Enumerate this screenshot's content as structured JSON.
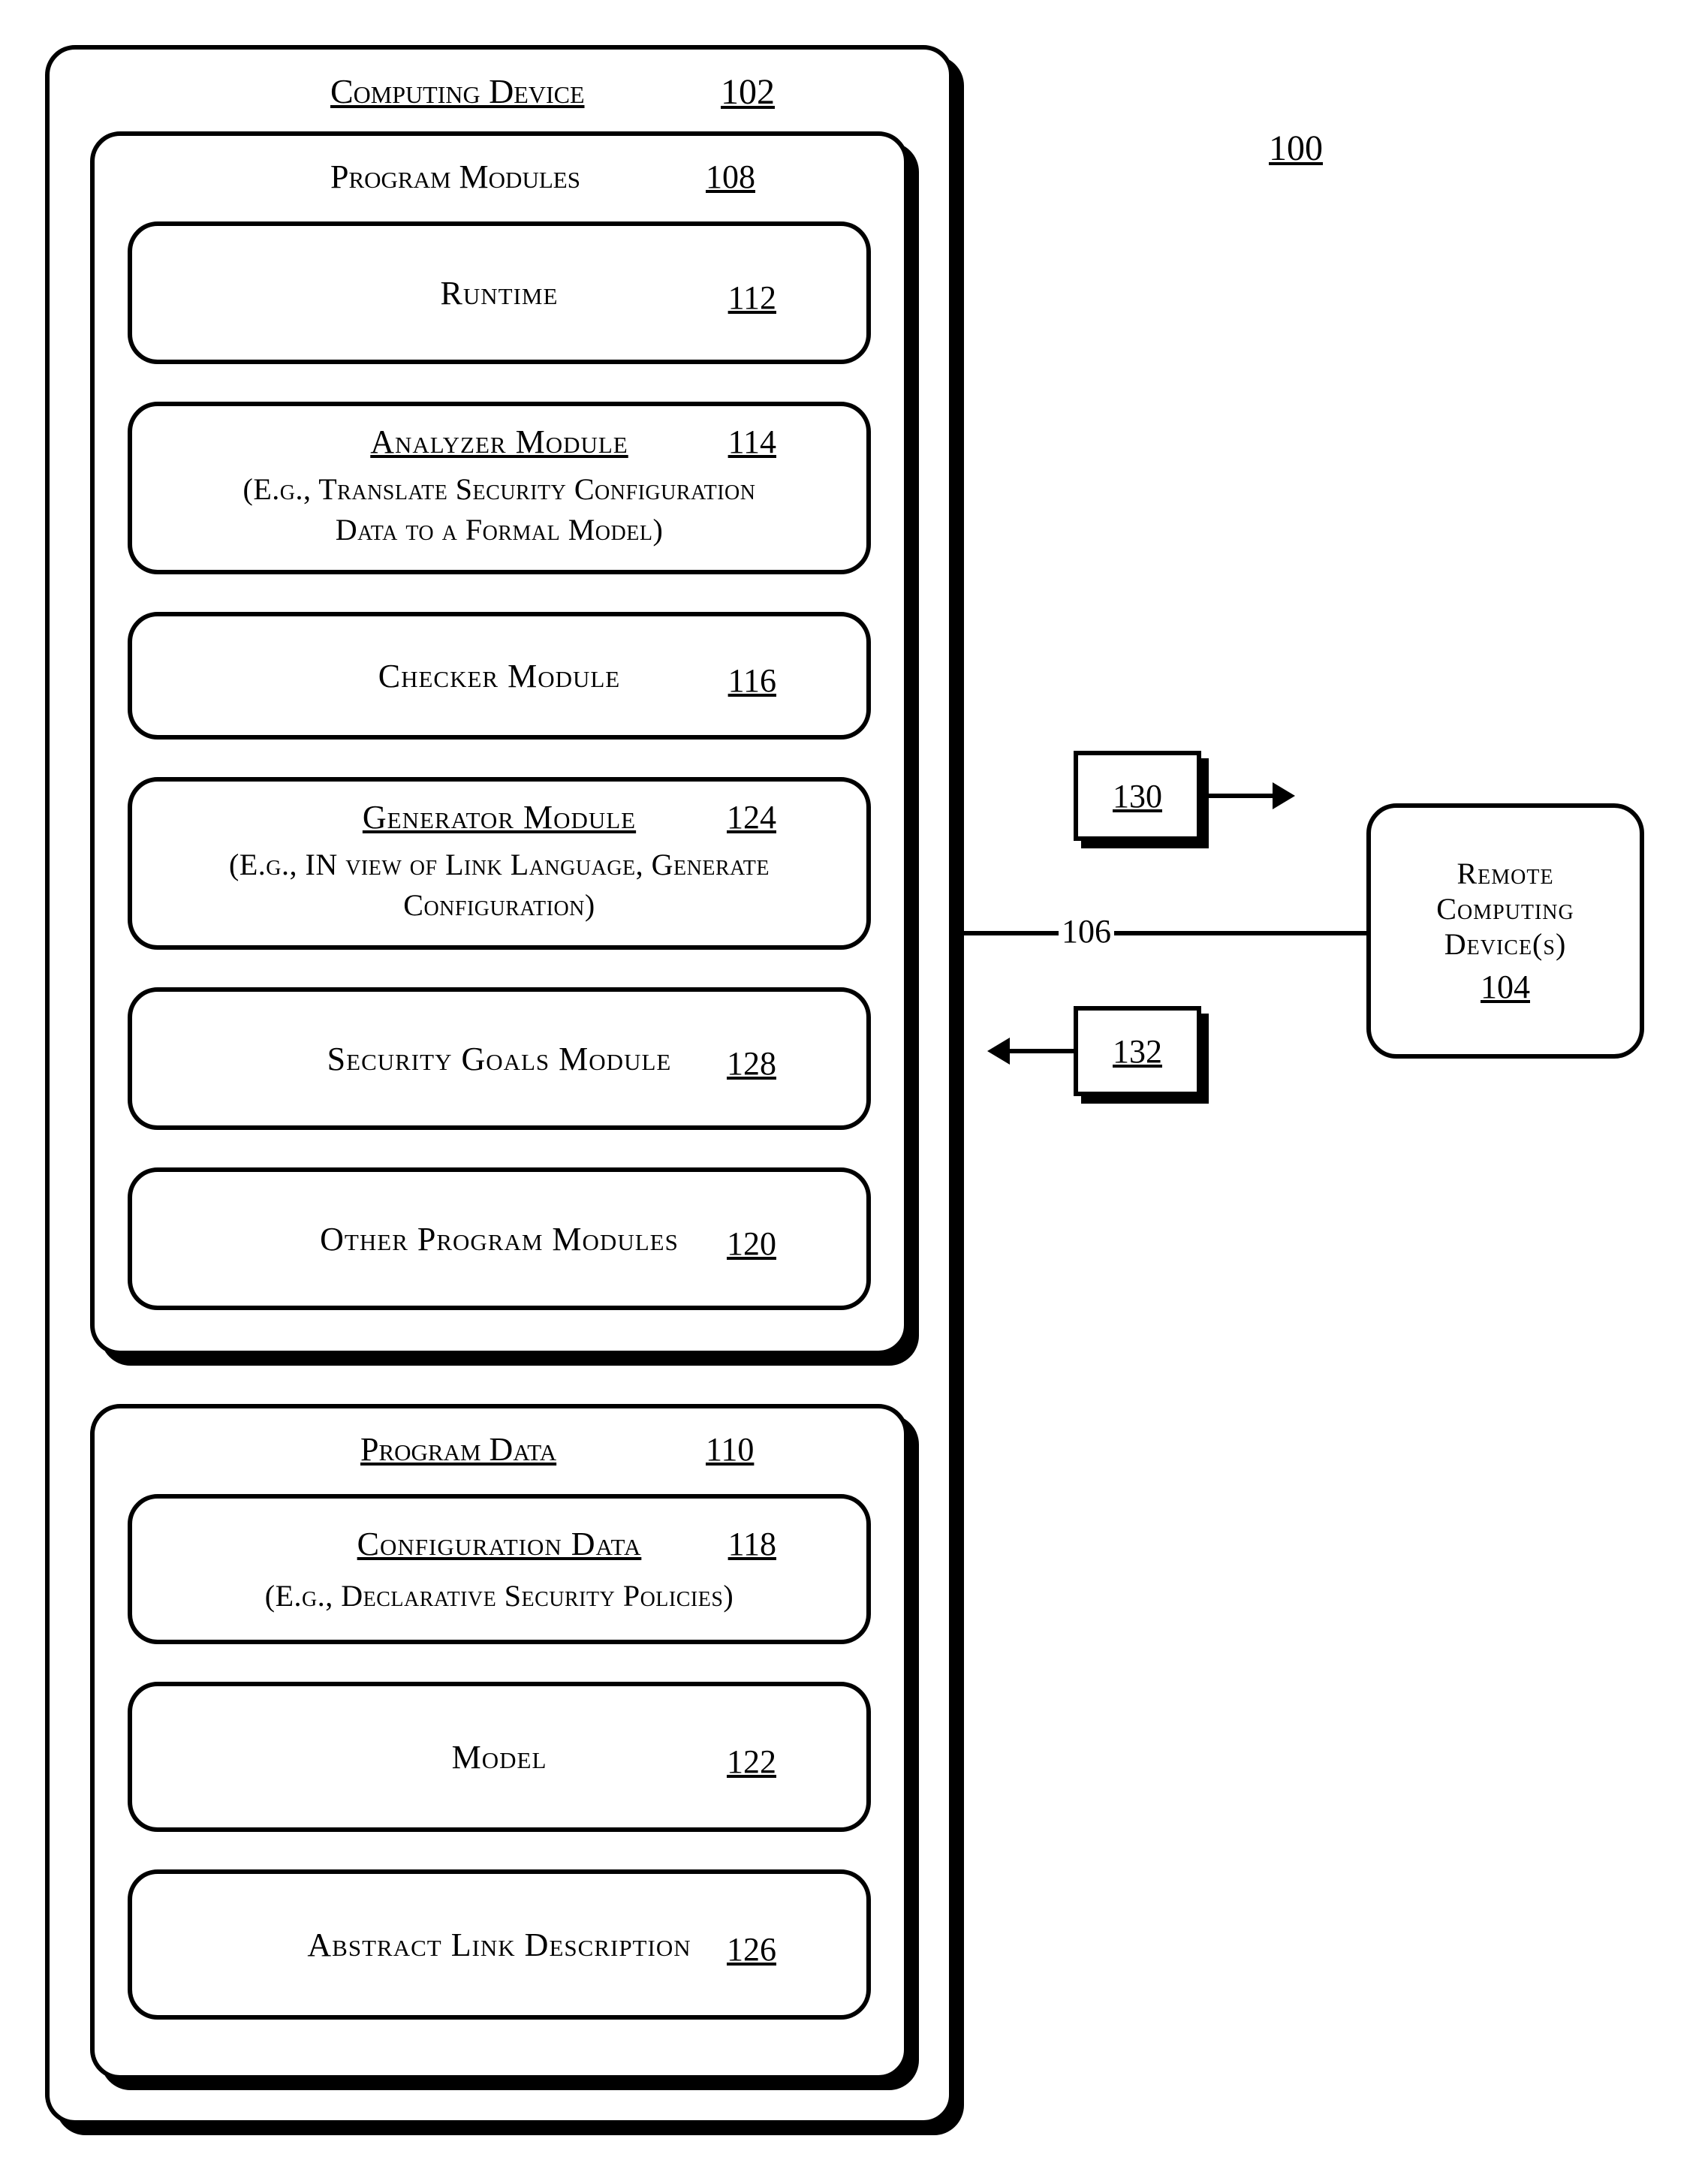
{
  "figure_ref": "100",
  "computing_device": {
    "title": "Computing Device",
    "ref": "102"
  },
  "program_modules": {
    "title": "Program Modules",
    "ref": "108"
  },
  "runtime": {
    "title": "Runtime",
    "ref": "112"
  },
  "analyzer": {
    "title": "Analyzer Module",
    "ref": "114",
    "sub1": "(E.g., Translate  Security Configuration",
    "sub2": "Data to a Formal Model)"
  },
  "checker": {
    "title": "Checker Module",
    "ref": "116"
  },
  "generator": {
    "title": "Generator Module",
    "ref": "124",
    "sub1": "(E.g., IN view of Link Language, Generate",
    "sub2": "Configuration)"
  },
  "security_goals": {
    "title": "Security Goals Module",
    "ref": "128"
  },
  "other_modules": {
    "title": "Other Program Modules",
    "ref": "120"
  },
  "program_data": {
    "title": "Program Data",
    "ref": "110"
  },
  "config_data": {
    "title": "Configuration Data",
    "ref": "118",
    "sub": "(E.g., Declarative Security Policies)"
  },
  "model": {
    "title": "Model",
    "ref": "122"
  },
  "abstract_link": {
    "title": "Abstract Link Description",
    "ref": "126"
  },
  "connection": {
    "ref": "106"
  },
  "msg_out": {
    "ref": "130"
  },
  "msg_in": {
    "ref": "132"
  },
  "remote": {
    "line1": "Remote",
    "line2": "Computing",
    "line3": "Device(s)",
    "ref": "104"
  }
}
